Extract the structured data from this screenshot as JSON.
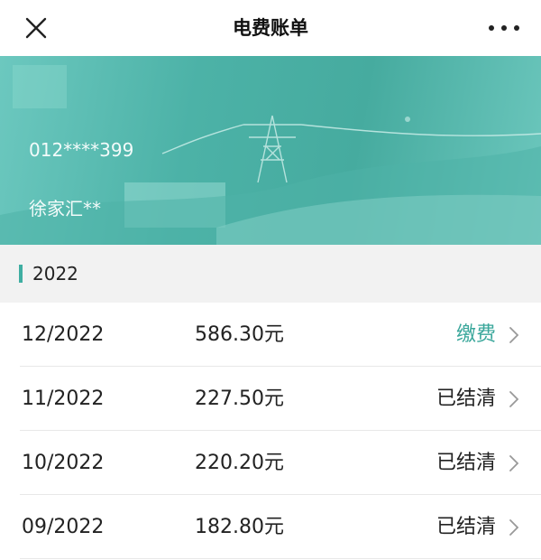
{
  "header": {
    "title": "电费账单",
    "close_icon": "close-icon",
    "more_icon": "more-horizontal-icon"
  },
  "banner": {
    "account": "012****399",
    "address": "徐家汇**"
  },
  "year": {
    "label": "2022"
  },
  "bills": [
    {
      "month": "12/2022",
      "amount": "586.30元",
      "status": "缴费",
      "pay": true
    },
    {
      "month": "11/2022",
      "amount": "227.50元",
      "status": "已结清",
      "pay": false
    },
    {
      "month": "10/2022",
      "amount": "220.20元",
      "status": "已结清",
      "pay": false
    },
    {
      "month": "09/2022",
      "amount": "182.80元",
      "status": "已结清",
      "pay": false
    }
  ],
  "colors": {
    "accent": "#3aa79b",
    "banner": "#4cb2a7",
    "section_bg": "#f2f2f2"
  }
}
